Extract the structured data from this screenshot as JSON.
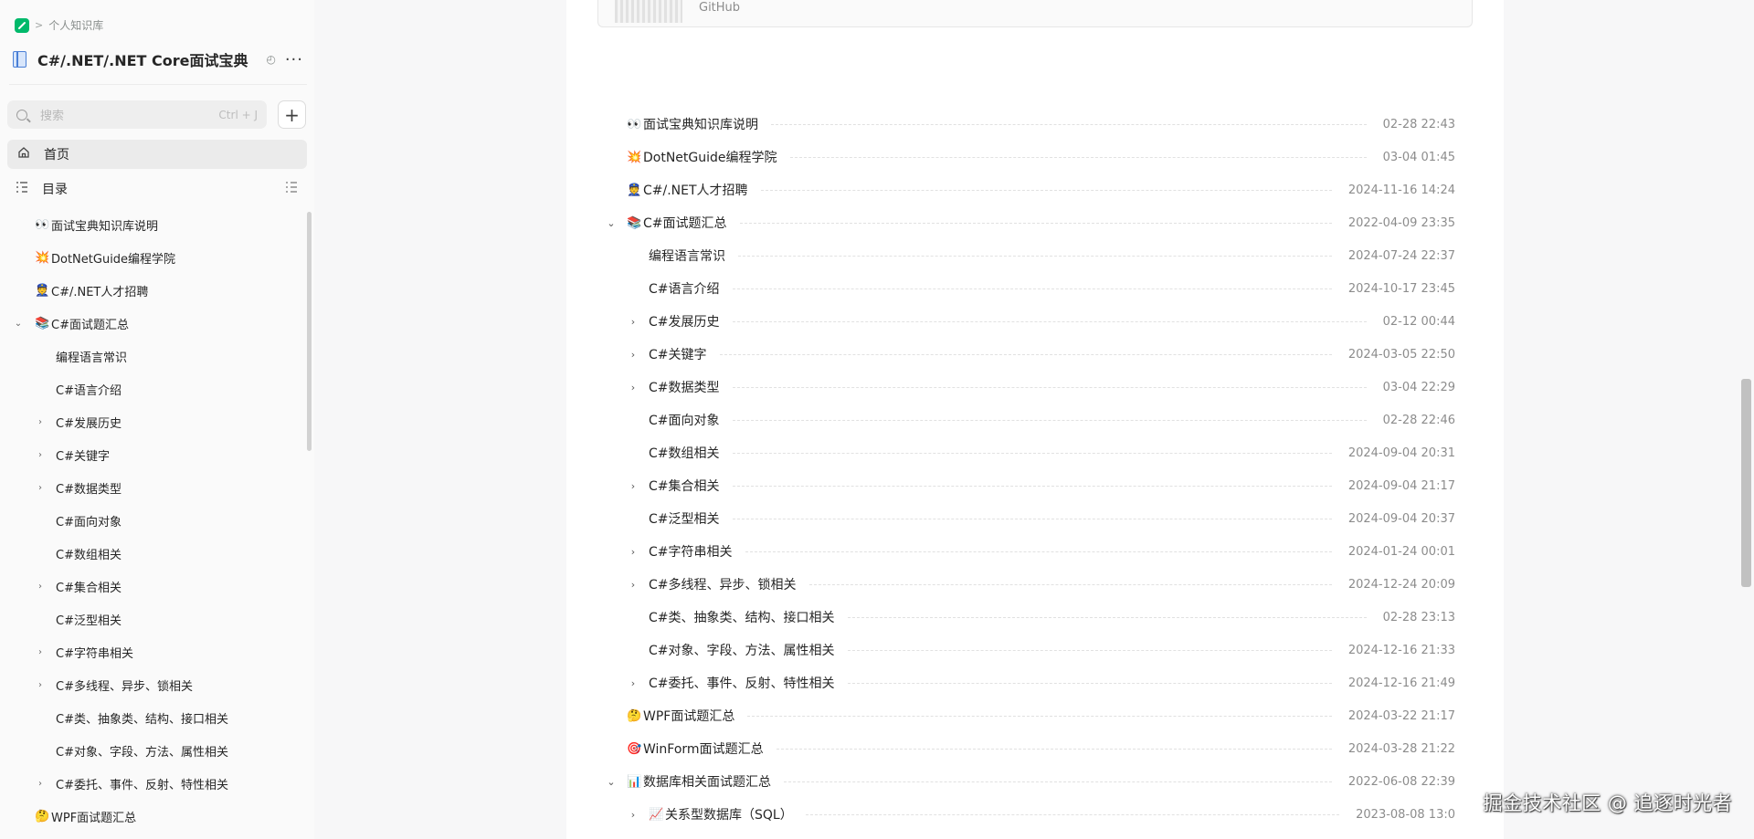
{
  "sidebar": {
    "breadcrumb": "个人知识库",
    "book_title": "C#/.NET/.NET Core面试宝典（...",
    "search_placeholder": "搜索",
    "search_shortcut": "Ctrl + J",
    "nav_home": "首页",
    "nav_toc": "目录",
    "items": [
      {
        "label": "面试宝典知识库说明",
        "emoji": "👀",
        "caret": ""
      },
      {
        "label": "DotNetGuide编程学院",
        "emoji": "💥",
        "caret": ""
      },
      {
        "label": "C#/.NET人才招聘",
        "emoji": "👮",
        "caret": ""
      },
      {
        "label": "C#面试题汇总",
        "emoji": "📚",
        "caret": "⌄"
      },
      {
        "label": "编程语言常识",
        "emoji": "",
        "caret": ""
      },
      {
        "label": "C#语言介绍",
        "emoji": "",
        "caret": ""
      },
      {
        "label": "C#发展历史",
        "emoji": "",
        "caret": "›"
      },
      {
        "label": "C#关键字",
        "emoji": "",
        "caret": "›"
      },
      {
        "label": "C#数据类型",
        "emoji": "",
        "caret": "›"
      },
      {
        "label": "C#面向对象",
        "emoji": "",
        "caret": ""
      },
      {
        "label": "C#数组相关",
        "emoji": "",
        "caret": ""
      },
      {
        "label": "C#集合相关",
        "emoji": "",
        "caret": "›"
      },
      {
        "label": "C#泛型相关",
        "emoji": "",
        "caret": ""
      },
      {
        "label": "C#字符串相关",
        "emoji": "",
        "caret": "›"
      },
      {
        "label": "C#多线程、异步、锁相关",
        "emoji": "",
        "caret": "›"
      },
      {
        "label": "C#类、抽象类、结构、接口相关",
        "emoji": "",
        "caret": ""
      },
      {
        "label": "C#对象、字段、方法、属性相关",
        "emoji": "",
        "caret": ""
      },
      {
        "label": "C#委托、事件、反射、特性相关",
        "emoji": "",
        "caret": "›"
      },
      {
        "label": "WPF面试题汇总",
        "emoji": "🤔",
        "caret": ""
      }
    ]
  },
  "main": {
    "card_label": "GitHub",
    "docs": [
      {
        "title": "面试宝典知识库说明",
        "emoji": "👀",
        "caret": "",
        "date": "02-28 22:43"
      },
      {
        "title": "DotNetGuide编程学院",
        "emoji": "💥",
        "caret": "",
        "date": "03-04 01:45"
      },
      {
        "title": "C#/.NET人才招聘",
        "emoji": "👮",
        "caret": "",
        "date": "2024-11-16 14:24"
      },
      {
        "title": "C#面试题汇总",
        "emoji": "📚",
        "caret": "⌄",
        "date": "2022-04-09 23:35"
      },
      {
        "title": "编程语言常识",
        "emoji": "",
        "caret": "",
        "date": "2024-07-24 22:37"
      },
      {
        "title": "C#语言介绍",
        "emoji": "",
        "caret": "",
        "date": "2024-10-17 23:45"
      },
      {
        "title": "C#发展历史",
        "emoji": "",
        "caret": "›",
        "date": "02-12 00:44"
      },
      {
        "title": "C#关键字",
        "emoji": "",
        "caret": "›",
        "date": "2024-03-05 22:50"
      },
      {
        "title": "C#数据类型",
        "emoji": "",
        "caret": "›",
        "date": "03-04 22:29"
      },
      {
        "title": "C#面向对象",
        "emoji": "",
        "caret": "",
        "date": "02-28 22:46"
      },
      {
        "title": "C#数组相关",
        "emoji": "",
        "caret": "",
        "date": "2024-09-04 20:31"
      },
      {
        "title": "C#集合相关",
        "emoji": "",
        "caret": "›",
        "date": "2024-09-04 21:17"
      },
      {
        "title": "C#泛型相关",
        "emoji": "",
        "caret": "",
        "date": "2024-09-04 20:37"
      },
      {
        "title": "C#字符串相关",
        "emoji": "",
        "caret": "›",
        "date": "2024-01-24 00:01"
      },
      {
        "title": "C#多线程、异步、锁相关",
        "emoji": "",
        "caret": "›",
        "date": "2024-12-24 20:09"
      },
      {
        "title": "C#类、抽象类、结构、接口相关",
        "emoji": "",
        "caret": "",
        "date": "02-28 23:13"
      },
      {
        "title": "C#对象、字段、方法、属性相关",
        "emoji": "",
        "caret": "",
        "date": "2024-12-16 21:33"
      },
      {
        "title": "C#委托、事件、反射、特性相关",
        "emoji": "",
        "caret": "›",
        "date": "2024-12-16 21:49"
      },
      {
        "title": "WPF面试题汇总",
        "emoji": "🤔",
        "caret": "",
        "date": "2024-03-22 21:17"
      },
      {
        "title": "WinForm面试题汇总",
        "emoji": "🎯",
        "caret": "",
        "date": "2024-03-28 21:22"
      },
      {
        "title": "数据库相关面试题汇总",
        "emoji": "📊",
        "caret": "⌄",
        "date": "2022-06-08 22:39"
      },
      {
        "title": "关系型数据库（SQL）",
        "emoji": "📈",
        "caret": "›",
        "date": "2023-08-08 13:0"
      }
    ]
  },
  "watermark": "掘金技术社区 @ 追逐时光者"
}
